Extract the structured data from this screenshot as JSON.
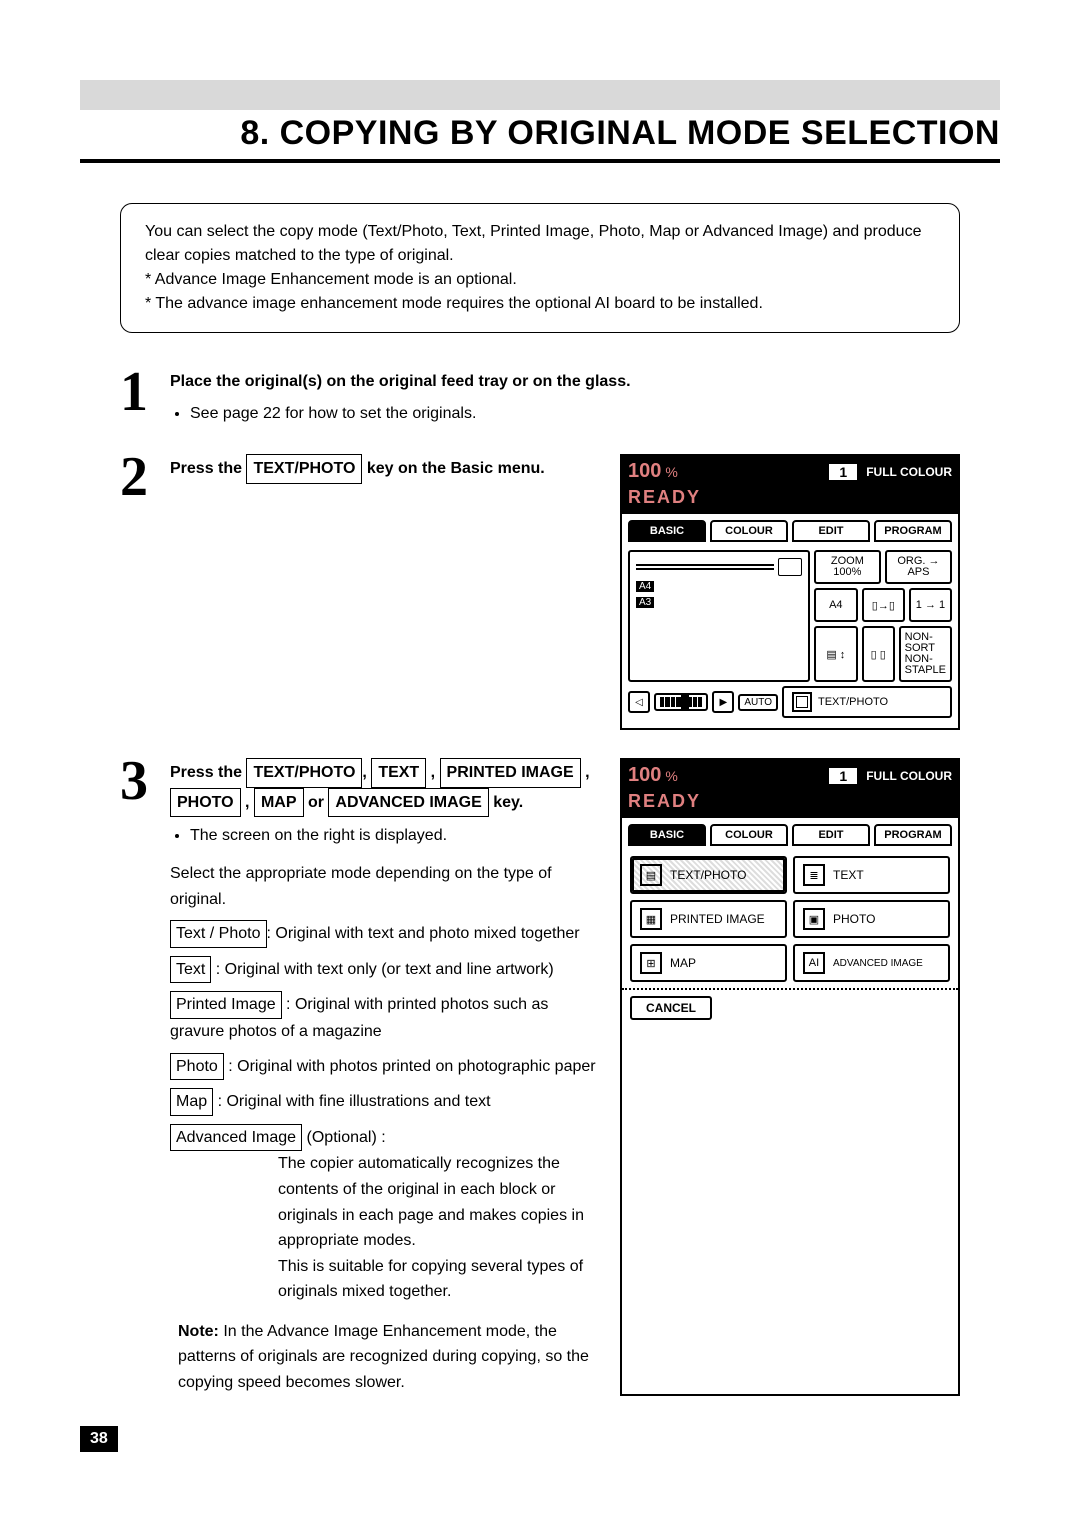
{
  "title": "8.  COPYING BY ORIGINAL MODE SELECTION",
  "intro": {
    "line1": "You can select the copy mode (Text/Photo, Text, Printed Image, Photo, Map or Advanced Image) and produce clear copies matched to the type of original.",
    "line2": "* Advance Image Enhancement mode is an optional.",
    "line3": "* The advance image enhancement mode requires the optional AI board to be installed."
  },
  "step1": {
    "num": "1",
    "lead": "Place the original(s) on the original feed tray or on the glass.",
    "bullet": "See page 22 for how to set the originals."
  },
  "step2": {
    "num": "2",
    "lead_pre": "Press the ",
    "lead_btn": "TEXT/PHOTO",
    "lead_post": " key on the Basic menu."
  },
  "step3": {
    "num": "3",
    "lead_pre": "Press the ",
    "b1": "TEXT/PHOTO",
    "c1": ", ",
    "b2": "TEXT",
    "c2": " , ",
    "b3": "PRINTED IMAGE",
    "c3": " , ",
    "b4": "PHOTO",
    "c4": " , ",
    "b5": "MAP",
    "c5": " or ",
    "b6": "ADVANCED IMAGE",
    "lead_post": "  key.",
    "bullet": "The screen on the right is displayed.",
    "select_line": "Select the appropriate mode depending on the type of original.",
    "modes": {
      "tp_label": "Text / Photo",
      "tp_desc": ": Original with text and photo mixed together",
      "t_label": "Text",
      "t_desc": " : Original with text only (or text and line artwork)",
      "pi_label": "Printed Image",
      "pi_desc": " : Original with printed photos such as gravure photos of a magazine",
      "p_label": "Photo",
      "p_desc": " : Original with photos printed on photographic paper",
      "m_label": "Map",
      "m_desc": " : Original with fine illustrations and text",
      "ai_label": "Advanced Image",
      "ai_opt": " (Optional) :",
      "ai_desc1": "The copier automatically recognizes the contents of the original in each block or originals in each page and makes copies in appropriate modes.",
      "ai_desc2": "This is suitable for copying several types of originals mixed together."
    },
    "note_label": "Note:",
    "note_body": "In the Advance Image Enhancement mode, the patterns of originals are recognized during copying, so the copying speed becomes slower."
  },
  "panel_basic": {
    "zoom": "100",
    "pct": "%",
    "copies": "1",
    "full_colour": "FULL COLOUR",
    "ready": "READY",
    "tabs": {
      "basic": "BASIC",
      "colour": "COLOUR",
      "edit": "EDIT",
      "program": "PROGRAM"
    },
    "zoom_label": "ZOOM",
    "zoom_val": "100%",
    "org_label": "ORG.",
    "aps": "APS",
    "a4r": "A4",
    "a4_btn": "A4",
    "a4p": "A4",
    "a3p": "A3",
    "one_to_one": "1 → 1",
    "nonsort": "NON-SORT",
    "nonstaple": "NON-STAPLE",
    "auto": "AUTO",
    "textphoto": "TEXT/PHOTO"
  },
  "panel_modes": {
    "zoom": "100",
    "pct": "%",
    "copies": "1",
    "full_colour": "FULL COLOUR",
    "ready": "READY",
    "tabs": {
      "basic": "BASIC",
      "colour": "COLOUR",
      "edit": "EDIT",
      "program": "PROGRAM"
    },
    "btns": {
      "textphoto": "TEXT/PHOTO",
      "text": "TEXT",
      "printed": "PRINTED IMAGE",
      "photo": "PHOTO",
      "map": "MAP",
      "advanced": "ADVANCED IMAGE"
    },
    "cancel": "CANCEL"
  },
  "page_number": "38"
}
